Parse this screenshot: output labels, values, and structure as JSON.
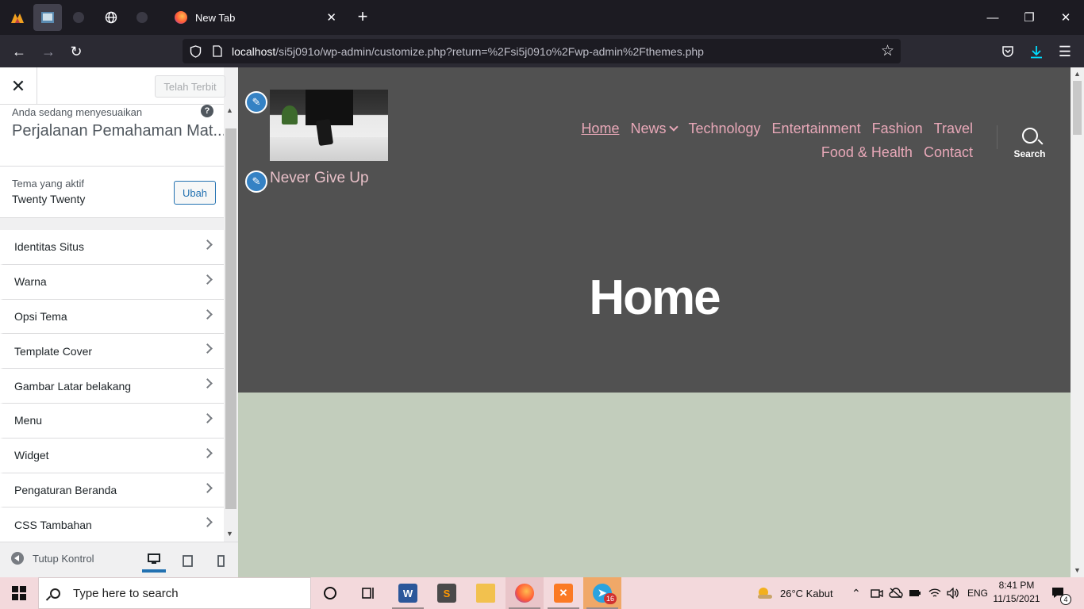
{
  "browser": {
    "tab_title": "New Tab",
    "url_host": "localhost",
    "url_path": "/si5j091o/wp-admin/customize.php?return=%2Fsi5j091o%2Fwp-admin%2Fthemes.php"
  },
  "customizer": {
    "published_label": "Telah Terbit",
    "customizing_label": "Anda sedang menyesuaikan",
    "site_title": "Perjalanan Pemahaman Mat...",
    "active_theme_label": "Tema yang aktif",
    "active_theme_name": "Twenty Twenty",
    "change_button": "Ubah",
    "sections": [
      {
        "label": "Identitas Situs"
      },
      {
        "label": "Warna"
      },
      {
        "label": "Opsi Tema"
      },
      {
        "label": "Template Cover"
      },
      {
        "label": "Gambar Latar belakang"
      },
      {
        "label": "Menu"
      },
      {
        "label": "Widget"
      },
      {
        "label": "Pengaturan Beranda"
      },
      {
        "label": "CSS Tambahan"
      }
    ],
    "collapse_label": "Tutup Kontrol"
  },
  "preview": {
    "tagline": "Never Give Up",
    "menu": [
      "Home",
      "News",
      "Technology",
      "Entertainment",
      "Fashion",
      "Travel",
      "Food & Health",
      "Contact"
    ],
    "search_label": "Search",
    "page_title": "Home",
    "hero_color": "#515151",
    "body_color": "#c2cdbc",
    "link_color": "#e8a8b8"
  },
  "taskbar": {
    "search_placeholder": "Type here to search",
    "weather": "26°C  Kabut",
    "language": "ENG",
    "time": "8:41 PM",
    "date": "11/15/2021",
    "telegram_badge": "16",
    "notification_count": "4"
  }
}
